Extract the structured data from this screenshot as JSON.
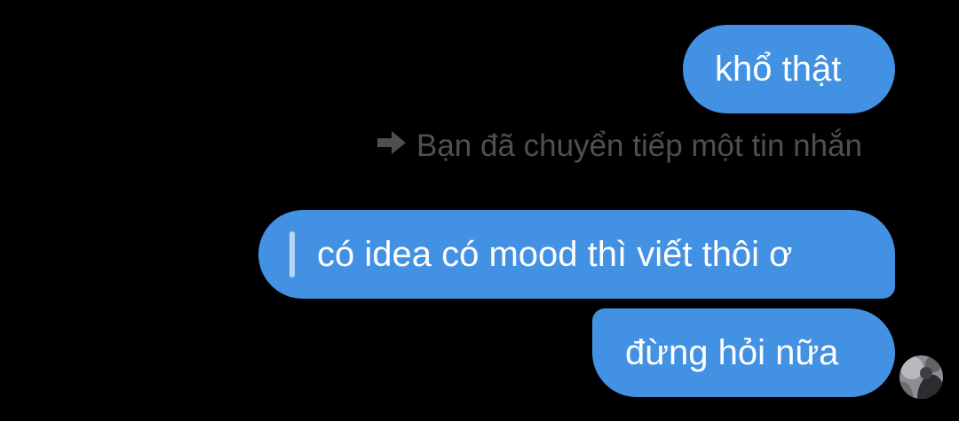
{
  "messages": [
    {
      "text": "khổ thật"
    },
    {
      "text": "có idea có mood thì viết thôi ơ"
    },
    {
      "text": "đừng hỏi nữa"
    }
  ],
  "forward_notice": {
    "icon": "forward-arrow-icon",
    "text": "Bạn đã chuyển tiếp một tin nhắn"
  },
  "avatar": {
    "icon": "user-avatar"
  },
  "colors": {
    "background": "#000000",
    "bubble": "#4291e3",
    "bubble_text": "#ffffff",
    "notice_text": "#4f4f4f",
    "quote_bar": "#b9d6f4"
  }
}
